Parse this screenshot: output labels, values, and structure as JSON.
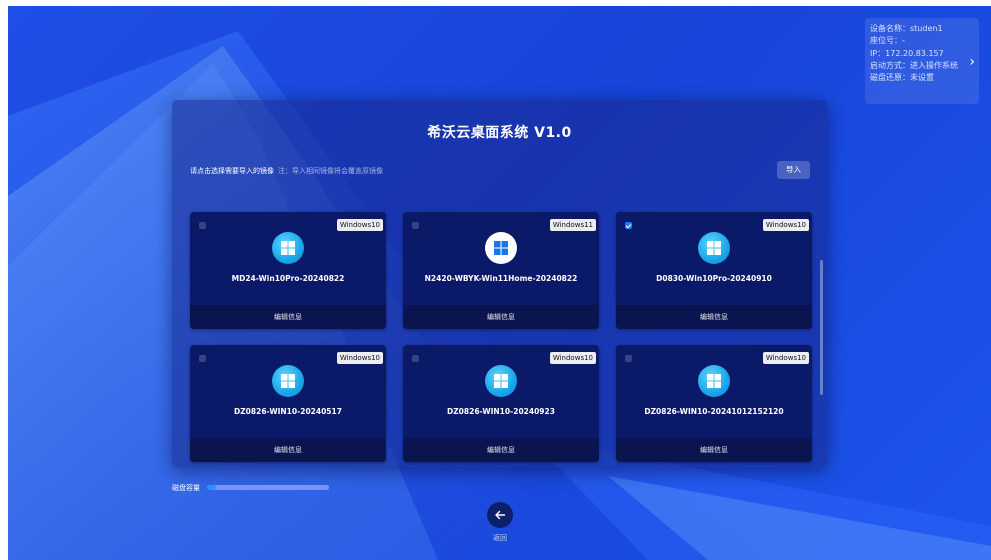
{
  "device_info": {
    "rows": [
      "设备名称：studen1",
      "座位号：-",
      "IP：172.20.83.157",
      "启动方式：进入操作系统",
      "磁盘还原：未设置"
    ],
    "expand_icon": "chevron-right-icon"
  },
  "dialog": {
    "title": "希沃云桌面系统 V1.0",
    "hint": "请点击选择需要导入的镜像",
    "hint_note": "注：导入相同镜像将会覆盖原镜像",
    "import_label": "导入"
  },
  "images": [
    {
      "os": "Windows10",
      "name": "MD24-Win10Pro-20240822",
      "edit_label": "编辑信息",
      "checked": false,
      "logo": "windows10-logo-icon"
    },
    {
      "os": "Windows11",
      "name": "N2420-WBYK-Win11Home-20240822",
      "edit_label": "编辑信息",
      "checked": false,
      "logo": "windows11-logo-icon"
    },
    {
      "os": "Windows10",
      "name": "D0830-Win10Pro-20240910",
      "edit_label": "编辑信息",
      "checked": true,
      "logo": "windows10-logo-icon"
    },
    {
      "os": "Windows10",
      "name": "DZ0826-WIN10-20240517",
      "edit_label": "编辑信息",
      "checked": false,
      "logo": "windows10-logo-icon"
    },
    {
      "os": "Windows10",
      "name": "DZ0826-WIN10-20240923",
      "edit_label": "编辑信息",
      "checked": false,
      "logo": "windows10-logo-icon"
    },
    {
      "os": "Windows10",
      "name": "DZ0826-WIN10-20241012152120",
      "edit_label": "编辑信息",
      "checked": false,
      "logo": "windows10-logo-icon"
    }
  ],
  "disk": {
    "label": "磁盘容量",
    "used_fraction": 0.07
  },
  "back": {
    "label": "返回",
    "icon": "arrow-left-icon"
  },
  "colors": {
    "accent": "#1e7bff",
    "background": "#1f4fe6",
    "card": "#0b1a68"
  }
}
